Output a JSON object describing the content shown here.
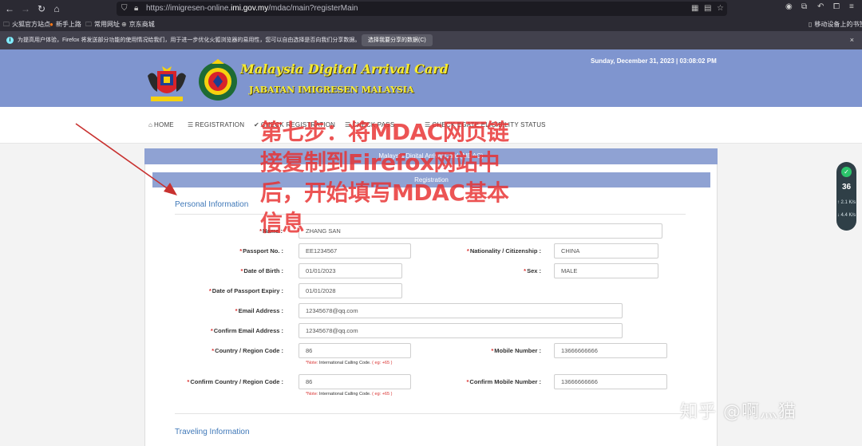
{
  "browser": {
    "back_icon": "arrow-left-icon",
    "forward_icon": "arrow-right-icon",
    "reload_icon": "reload-icon",
    "home_icon": "home-icon",
    "url_prefix": "https://imigresen-online.",
    "url_domain": "imi.gov.my",
    "url_suffix": "/mdac/main?registerMain"
  },
  "bookmarks": [
    {
      "label": "火狐官方站点",
      "icon": "folder-icon"
    },
    {
      "label": "新手上路",
      "icon": "firefox-icon"
    },
    {
      "label": "常用网址",
      "icon": "folder-icon"
    },
    {
      "label": "京东商城",
      "icon": "globe-icon"
    },
    {
      "label": "移动设备上的书签",
      "icon": "mobile-icon"
    }
  ],
  "notice": {
    "text": "为提高用户体验，Firefox 将发送部分功能的使用情况给我们，用于进一步优化火狐浏览器的易用性，您可以自由选择是否向我们分享数据。",
    "button": "选择我要分享的数据(C)",
    "close": "×"
  },
  "banner": {
    "title": "Malaysia Digital Arrival Card",
    "subtitle": "JABATAN IMIGRESEN MALAYSIA",
    "date": "Sunday, December 31, 2023 | 03:08:02 PM",
    "bg_color": "#7f95cf",
    "title_color": "#f7ec2e"
  },
  "nav": {
    "home": "HOME",
    "registration": "REGISTRATION",
    "check_registration": "CHECK REGISTRATION",
    "check_pass": "CHECK PASS",
    "check_e_pass": "CHECK EGATE ELIGIBILITY STATUS"
  },
  "form": {
    "card_title": "Malaysia Digital Arrival Card (MDAC)",
    "header": "Registration",
    "personal_section": "Personal Information",
    "traveling_section": "Traveling Information",
    "req": "*",
    "fields": {
      "name_label": "Name :",
      "name": "ZHANG SAN",
      "passport_label": "Passport No. :",
      "passport": "EE1234567",
      "nationality_label": "Nationality / Citizenship :",
      "nationality": "CHINA",
      "dob_label": "Date of Birth :",
      "dob": "01/01/2023",
      "sex_label": "Sex :",
      "sex": "MALE",
      "expiry_label": "Date of Passport Expiry :",
      "expiry": "01/01/2028",
      "email_label": "Email Address :",
      "email": "12345678@qq.com",
      "confirm_email_label": "Confirm Email Address :",
      "confirm_email": "12345678@qq.com",
      "country_code_label": "Country / Region Code :",
      "country_code": "86",
      "mobile_label": "Mobile Number :",
      "mobile": "13666666666",
      "confirm_country_code_label": "Confirm Country / Region Code :",
      "confirm_country_code": "86",
      "confirm_mobile_label": "Confirm Mobile Number :",
      "confirm_mobile": "13666666666"
    },
    "note_prefix": "*Note:",
    "note_text": " International Calling Code. ",
    "note_example": "( eg: +65 )"
  },
  "overlay": {
    "lines": [
      "第七步：将MDAC网页链",
      "接复制到Firefox网站中",
      "后，开始填写MDAC基本",
      "信息"
    ],
    "color": "#e82e2e"
  },
  "side_widget": {
    "shield_icon": "shield-check-icon",
    "value": "36",
    "line1": "↑ 2.1 K/s",
    "line2": "↓ 4.4 K/s"
  },
  "watermark": "知乎 @啊灬猫"
}
